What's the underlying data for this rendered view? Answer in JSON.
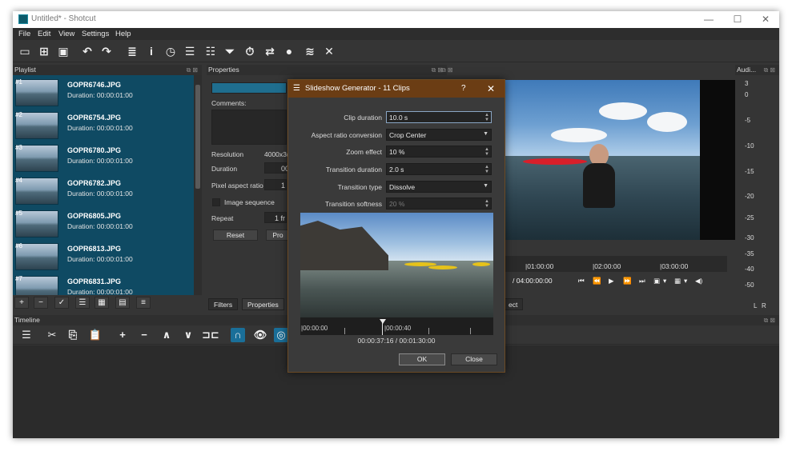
{
  "window": {
    "title": "Untitled* - Shotcut",
    "minimize": "—",
    "maximize": "☐",
    "close": "✕"
  },
  "menu": [
    "File",
    "Edit",
    "View",
    "Settings",
    "Help"
  ],
  "toolbar_icons": [
    "open-file-icon",
    "open-other-icon",
    "save-icon",
    "undo-icon",
    "redo-icon",
    "peak-meter-icon",
    "properties-icon",
    "recent-icon",
    "playlist-icon",
    "timeline-icon",
    "filters-icon",
    "history-icon",
    "encode-icon",
    "jobs-icon",
    "keyframes-icon",
    "markers-icon",
    "fullscreen-icon"
  ],
  "docks": {
    "playlist": "Playlist",
    "properties": "Properties",
    "audio": "Audi...",
    "timeline": "Timeline"
  },
  "playlist": {
    "items": [
      {
        "num": "#1",
        "name": "GOPR6746.JPG",
        "duration": "Duration: 00:00:01:00"
      },
      {
        "num": "#2",
        "name": "GOPR6754.JPG",
        "duration": "Duration: 00:00:01:00"
      },
      {
        "num": "#3",
        "name": "GOPR6780.JPG",
        "duration": "Duration: 00:00:01:00"
      },
      {
        "num": "#4",
        "name": "GOPR6782.JPG",
        "duration": "Duration: 00:00:01:00"
      },
      {
        "num": "#5",
        "name": "GOPR6805.JPG",
        "duration": "Duration: 00:00:01:00"
      },
      {
        "num": "#6",
        "name": "GOPR6813.JPG",
        "duration": "Duration: 00:00:01:00"
      },
      {
        "num": "#7",
        "name": "GOPR6831.JPG",
        "duration": "Duration: 00:00:01:00"
      }
    ],
    "tools": [
      "+",
      "−",
      "✓",
      "☰",
      "▦",
      "▤",
      "≡"
    ]
  },
  "properties": {
    "comments_label": "Comments:",
    "resolution_label": "Resolution",
    "resolution_value": "4000x3(",
    "duration_label": "Duration",
    "duration_value": "00",
    "par_label": "Pixel aspect ratio",
    "par_value": "1",
    "image_sequence_label": "Image sequence",
    "repeat_label": "Repeat",
    "repeat_value": "1 fr",
    "reset_label": "Reset",
    "pro_label": "Pro"
  },
  "tabs": {
    "filters": "Filters",
    "properties": "Properties",
    "project": "ect"
  },
  "player": {
    "ruler": [
      "|01:00:00",
      "|02:00:00",
      "|03:00:00"
    ],
    "timecode": "/ 04:00:00:00",
    "controls": [
      "⏮",
      "⏪",
      "▶",
      "⏩",
      "⏭",
      "▣",
      "▾",
      "▦",
      "▾",
      "◀)"
    ]
  },
  "audio": {
    "scale": [
      "3",
      "0",
      "-5",
      "-10",
      "-15",
      "-20",
      "-25",
      "-30",
      "-35",
      "-40",
      "-50"
    ],
    "left": "L",
    "right": "R"
  },
  "timeline_tools": [
    "☰",
    "✂",
    "⎘",
    "📋",
    "+",
    "−",
    "∧",
    "∨",
    "⊐⊏",
    "∩",
    "👁",
    "◎"
  ],
  "dialog": {
    "title": "Slideshow Generator - 11 Clips",
    "help": "?",
    "close": "✕",
    "fields": [
      {
        "label": "Clip duration",
        "value": "10.0 s",
        "kind": "spin",
        "focus": true
      },
      {
        "label": "Aspect ratio conversion",
        "value": "Crop Center",
        "kind": "drop"
      },
      {
        "label": "Zoom effect",
        "value": "10 %",
        "kind": "spin"
      },
      {
        "label": "Transition duration",
        "value": "2.0 s",
        "kind": "spin"
      },
      {
        "label": "Transition type",
        "value": "Dissolve",
        "kind": "drop"
      },
      {
        "label": "Transition softness",
        "value": "20 %",
        "kind": "spin",
        "dim": true
      }
    ],
    "ruler": [
      "|00:00:00",
      "|00:00:40"
    ],
    "time": "00:00:37:16 / 00:01:30:00",
    "ok": "OK",
    "close_btn": "Close"
  }
}
